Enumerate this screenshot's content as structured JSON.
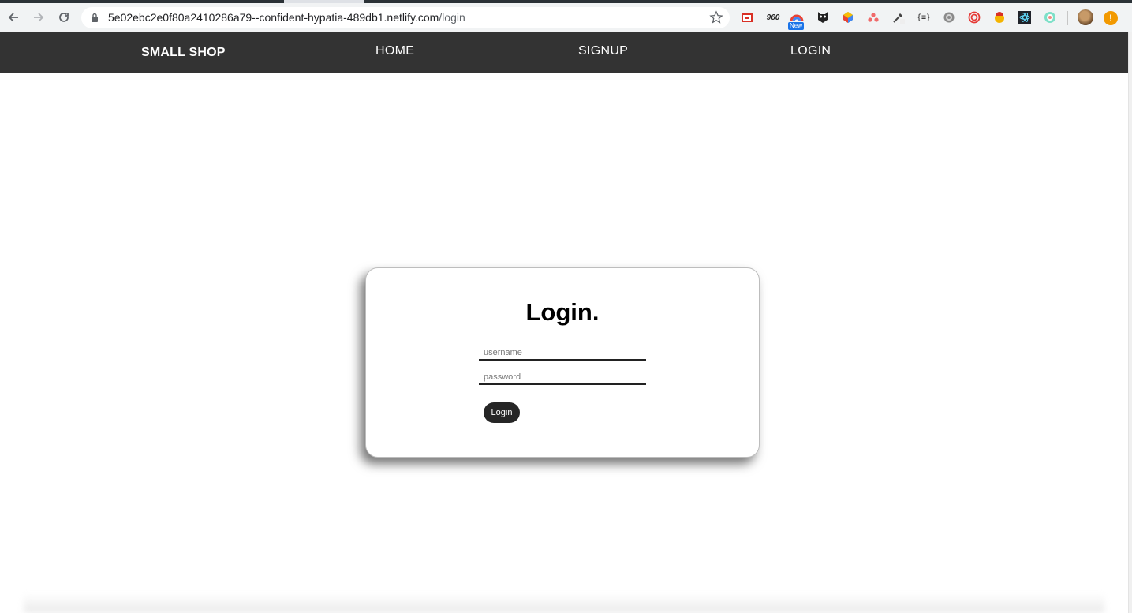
{
  "browser": {
    "url_host": "5e02ebc2e0f80a2410286a79--confident-hypatia-489db1.netlify.com",
    "url_path": "/login",
    "extensions": [
      "recorder-icon",
      "960-grid-icon",
      "color-wheel-icon",
      "owl-icon",
      "palette-icon",
      "asana-icon",
      "eyedropper-icon",
      "json-icon",
      "settings-gear-icon",
      "spiral-icon",
      "cookie-icon",
      "react-icon",
      "chroma-icon"
    ],
    "ext_960_label": "960",
    "ext_json_label": "{≡}",
    "new_badge": "New",
    "alert_label": "!"
  },
  "site_nav": {
    "brand": "SMALL SHOP",
    "links": [
      {
        "label": "HOME"
      },
      {
        "label": "SIGNUP"
      },
      {
        "label": "LOGIN"
      }
    ]
  },
  "login_card": {
    "title": "Login.",
    "username_placeholder": "username",
    "password_placeholder": "password",
    "submit_label": "Login"
  },
  "colors": {
    "nav_background": "#333333",
    "button_background": "#262626"
  }
}
